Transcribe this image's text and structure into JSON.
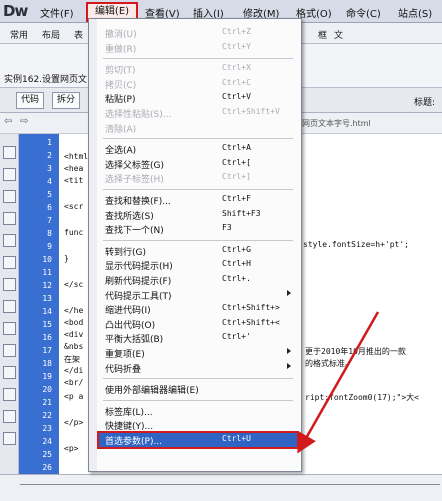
{
  "app": {
    "logo": "Dw"
  },
  "menubar": {
    "items": [
      "文件(F)",
      "编辑(E)",
      "查看(V)",
      "插入(I)",
      "修改(M)",
      "格式(O)",
      "命令(C)",
      "站点(S)"
    ],
    "active_index": 1
  },
  "insert_tabs": [
    "常用",
    "布局",
    "表",
    "框",
    "文"
  ],
  "document": {
    "title": "实例162.设置网页文",
    "file_path": "网页文本字号.html"
  },
  "view_buttons": [
    "代码",
    "拆分"
  ],
  "title_label": "标题:",
  "line_numbers": [
    "1",
    "2",
    "3",
    "4",
    "5",
    "6",
    "7",
    "8",
    "9",
    "10",
    "11",
    "12",
    "13",
    "14",
    "15",
    "16",
    "17",
    "18",
    "19",
    "20",
    "21",
    "22",
    "23",
    "24",
    "25",
    "26"
  ],
  "code_left": [
    "<html",
    "<hea",
    "<tit",
    "<scr",
    "func",
    "}",
    "</sc",
    "</he",
    "<bod",
    "<div",
    "&nbs",
    "在架",
    "</di",
    "<br/",
    "<p a",
    "</p>",
    "<p>"
  ],
  "code_right": [
    "style.fontSize=h+'pt';",
    "更于2010年10月推出的一款",
    "的格式标准。",
    "ript:fontZoom0(17);\">大<"
  ],
  "edit_menu": {
    "items": [
      {
        "label": "撤消(U)",
        "shortcut": "Ctrl+Z",
        "disabled": true
      },
      {
        "label": "重做(R)",
        "shortcut": "Ctrl+Y",
        "disabled": true
      },
      {
        "label": "剪切(T)",
        "shortcut": "Ctrl+X",
        "disabled": true
      },
      {
        "label": "拷贝(C)",
        "shortcut": "Ctrl+C",
        "disabled": true
      },
      {
        "label": "粘贴(P)",
        "shortcut": "Ctrl+V",
        "disabled": false
      },
      {
        "label": "选择性粘贴(S)...",
        "shortcut": "Ctrl+Shift+V",
        "disabled": true
      },
      {
        "label": "清除(A)",
        "shortcut": "",
        "disabled": true
      },
      {
        "label": "全选(A)",
        "shortcut": "Ctrl+A",
        "disabled": false
      },
      {
        "label": "选择父标签(G)",
        "shortcut": "Ctrl+[",
        "disabled": false
      },
      {
        "label": "选择子标签(H)",
        "shortcut": "Ctrl+]",
        "disabled": true
      },
      {
        "label": "查找和替换(F)...",
        "shortcut": "Ctrl+F",
        "disabled": false
      },
      {
        "label": "查找所选(S)",
        "shortcut": "Shift+F3",
        "disabled": false
      },
      {
        "label": "查找下一个(N)",
        "shortcut": "F3",
        "disabled": false
      },
      {
        "label": "转到行(G)",
        "shortcut": "Ctrl+G",
        "disabled": false
      },
      {
        "label": "显示代码提示(H)",
        "shortcut": "Ctrl+H",
        "disabled": false
      },
      {
        "label": "刷新代码提示(F)",
        "shortcut": "Ctrl+.",
        "disabled": false
      },
      {
        "label": "代码提示工具(T)",
        "shortcut": "",
        "disabled": false,
        "submenu": true
      },
      {
        "label": "缩进代码(I)",
        "shortcut": "Ctrl+Shift+>",
        "disabled": false
      },
      {
        "label": "凸出代码(O)",
        "shortcut": "Ctrl+Shift+<",
        "disabled": false
      },
      {
        "label": "平衡大括弧(B)",
        "shortcut": "Ctrl+'",
        "disabled": false
      },
      {
        "label": "重复项(E)",
        "shortcut": "",
        "disabled": false,
        "submenu": true
      },
      {
        "label": "代码折叠",
        "shortcut": "",
        "disabled": false,
        "submenu": true
      },
      {
        "label": "使用外部编辑器编辑(E)",
        "shortcut": "",
        "disabled": false
      },
      {
        "label": "标签库(L)...",
        "shortcut": "",
        "disabled": false
      },
      {
        "label": "快捷键(Y)...",
        "shortcut": "",
        "disabled": false
      },
      {
        "label": "首选参数(P)...",
        "shortcut": "Ctrl+U",
        "disabled": false,
        "selected": true
      }
    ]
  },
  "colors": {
    "highlight": "#d11a1a",
    "selection": "#2f63c4",
    "gutter": "#3a6fd2"
  }
}
